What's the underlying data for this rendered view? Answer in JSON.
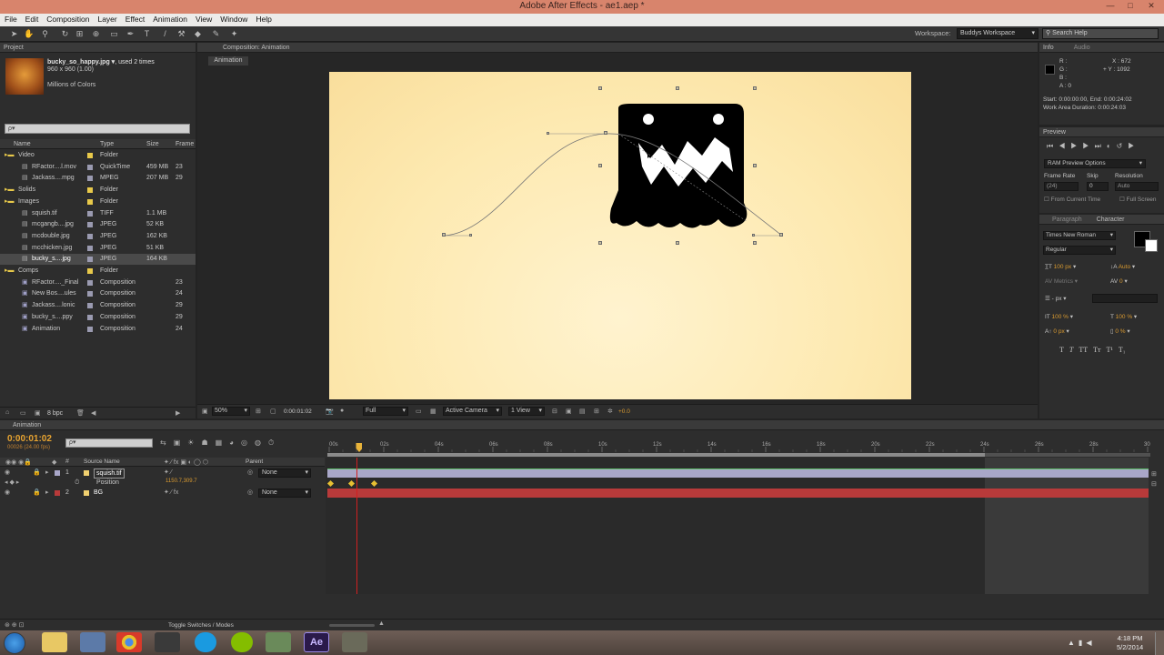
{
  "window": {
    "title": "Adobe After Effects - ae1.aep *"
  },
  "menu": [
    "File",
    "Edit",
    "Composition",
    "Layer",
    "Effect",
    "Animation",
    "View",
    "Window",
    "Help"
  ],
  "workspace": {
    "label": "Workspace:",
    "value": "Buddys Workspace",
    "search_placeholder": "Search Help"
  },
  "project": {
    "tab": "Project",
    "thumb_name": "bucky_so_happy.jpg ▾",
    "used": ", used 2 times",
    "dims": "960 x 960 (1.00)",
    "colors": "Millions of Colors",
    "search_placeholder": "ρ▾",
    "columns": [
      "Name",
      "Type",
      "Size",
      "Frame"
    ],
    "items": [
      {
        "name": "Video",
        "type": "Folder",
        "size": "",
        "frame": "",
        "indent": 0,
        "kind": "folder",
        "label": "#e8c94a"
      },
      {
        "name": "RFactor....l.mov",
        "type": "QuickTime",
        "size": "459 MB",
        "frame": "23",
        "indent": 1,
        "kind": "file",
        "label": "#9a9ab0"
      },
      {
        "name": "Jackass....mpg",
        "type": "MPEG",
        "size": "207 MB",
        "frame": "29",
        "indent": 1,
        "kind": "file",
        "label": "#9a9ab0"
      },
      {
        "name": "Solids",
        "type": "Folder",
        "size": "",
        "frame": "",
        "indent": 0,
        "kind": "folder",
        "label": "#e8c94a"
      },
      {
        "name": "Images",
        "type": "Folder",
        "size": "",
        "frame": "",
        "indent": 0,
        "kind": "folder",
        "label": "#e8c94a"
      },
      {
        "name": "squish.tif",
        "type": "TIFF",
        "size": "1.1 MB",
        "frame": "",
        "indent": 1,
        "kind": "image",
        "label": "#9a9ab0"
      },
      {
        "name": "mcgangb....jpg",
        "type": "JPEG",
        "size": "52 KB",
        "frame": "",
        "indent": 1,
        "kind": "image",
        "label": "#9a9ab0"
      },
      {
        "name": "mcdouble.jpg",
        "type": "JPEG",
        "size": "162 KB",
        "frame": "",
        "indent": 1,
        "kind": "image",
        "label": "#9a9ab0"
      },
      {
        "name": "mcchicken.jpg",
        "type": "JPEG",
        "size": "51 KB",
        "frame": "",
        "indent": 1,
        "kind": "image",
        "label": "#9a9ab0"
      },
      {
        "name": "bucky_s....jpg",
        "type": "JPEG",
        "size": "164 KB",
        "frame": "",
        "indent": 1,
        "kind": "image",
        "label": "#9a9ab0",
        "selected": true
      },
      {
        "name": "Comps",
        "type": "Folder",
        "size": "",
        "frame": "",
        "indent": 0,
        "kind": "folder",
        "label": "#e8c94a"
      },
      {
        "name": "RFactor...._Final",
        "type": "Composition",
        "size": "",
        "frame": "23",
        "indent": 1,
        "kind": "comp",
        "label": "#9a9ab0"
      },
      {
        "name": "New Bos....ules",
        "type": "Composition",
        "size": "",
        "frame": "24",
        "indent": 1,
        "kind": "comp",
        "label": "#9a9ab0"
      },
      {
        "name": "Jackass....lonic",
        "type": "Composition",
        "size": "",
        "frame": "29",
        "indent": 1,
        "kind": "comp",
        "label": "#9a9ab0"
      },
      {
        "name": "bucky_s....ppy",
        "type": "Composition",
        "size": "",
        "frame": "29",
        "indent": 1,
        "kind": "comp",
        "label": "#9a9ab0"
      },
      {
        "name": "Animation",
        "type": "Composition",
        "size": "",
        "frame": "24",
        "indent": 1,
        "kind": "comp",
        "label": "#9a9ab0"
      }
    ],
    "bpc": "8 bpc"
  },
  "composition": {
    "tab": "Composition: Animation",
    "subtab": "Animation",
    "zoom": "50%",
    "timecode": "0:00:01:02",
    "resolution": "Full",
    "camera": "Active Camera",
    "views": "1 View",
    "exposure": "+0.0"
  },
  "info": {
    "tabs": [
      "Info",
      "Audio"
    ],
    "r": "R :",
    "g": "G :",
    "b": "B :",
    "a": "A :  0",
    "x": "X : 672",
    "y": "Y : 1092",
    "start_end": "Start: 0:00:00:00, End: 0:00:24:02",
    "duration": "Work Area Duration: 0:00:24:03"
  },
  "preview": {
    "tab": "Preview",
    "ram": "RAM Preview Options",
    "frame_rate_label": "Frame Rate",
    "skip_label": "Skip",
    "resolution_label": "Resolution",
    "frame_rate": "(24)",
    "skip": "0",
    "resolution": "Auto",
    "from_current": "From Current Time",
    "full_screen": "Full Screen"
  },
  "character": {
    "tabs": [
      "Paragraph",
      "Character"
    ],
    "font": "Times New Roman",
    "style": "Regular",
    "size": "100 px",
    "leading": "Auto",
    "kerning": "Metrics",
    "tracking": "0",
    "stroke": "px",
    "vscale": "100 %",
    "hscale": "100 %",
    "baseline": "0 px",
    "tsume": "0 %",
    "styles": [
      "T",
      "T",
      "TT",
      "Tт",
      "T¹",
      "T₁"
    ]
  },
  "timeline": {
    "tab": "Animation",
    "timecode": "0:00:01:02",
    "frames": "00026 (24.00 fps)",
    "search_placeholder": "ρ▾",
    "col_source": "Source Name",
    "col_parent": "Parent",
    "ruler": [
      "00s",
      "02s",
      "04s",
      "06s",
      "08s",
      "10s",
      "12s",
      "14s",
      "16s",
      "18s",
      "20s",
      "22s",
      "24s",
      "26s",
      "28s",
      "30s"
    ],
    "layers": [
      {
        "num": "1",
        "name": "squish.tif",
        "parent": "None",
        "color": "#a9a7c9"
      },
      {
        "num": "2",
        "name": "BG",
        "parent": "None",
        "color": "#b83a3a"
      }
    ],
    "property": "Position",
    "position_value": "1150.7,309.7",
    "toggle_label": "Toggle Switches / Modes",
    "current_time_s": 1.083,
    "duration_s": 30,
    "work_area_end_s": 24.1,
    "keyframes_s": [
      0,
      0.75,
      1.6
    ]
  },
  "taskbar": {
    "time": "4:18 PM",
    "date": "5/2/2014"
  },
  "colors": {
    "accent_orange": "#e8a431",
    "comp_bg": "#fde9b0",
    "timeline_layer1": "#a9a7c9",
    "timeline_layer2": "#b83a3a"
  }
}
